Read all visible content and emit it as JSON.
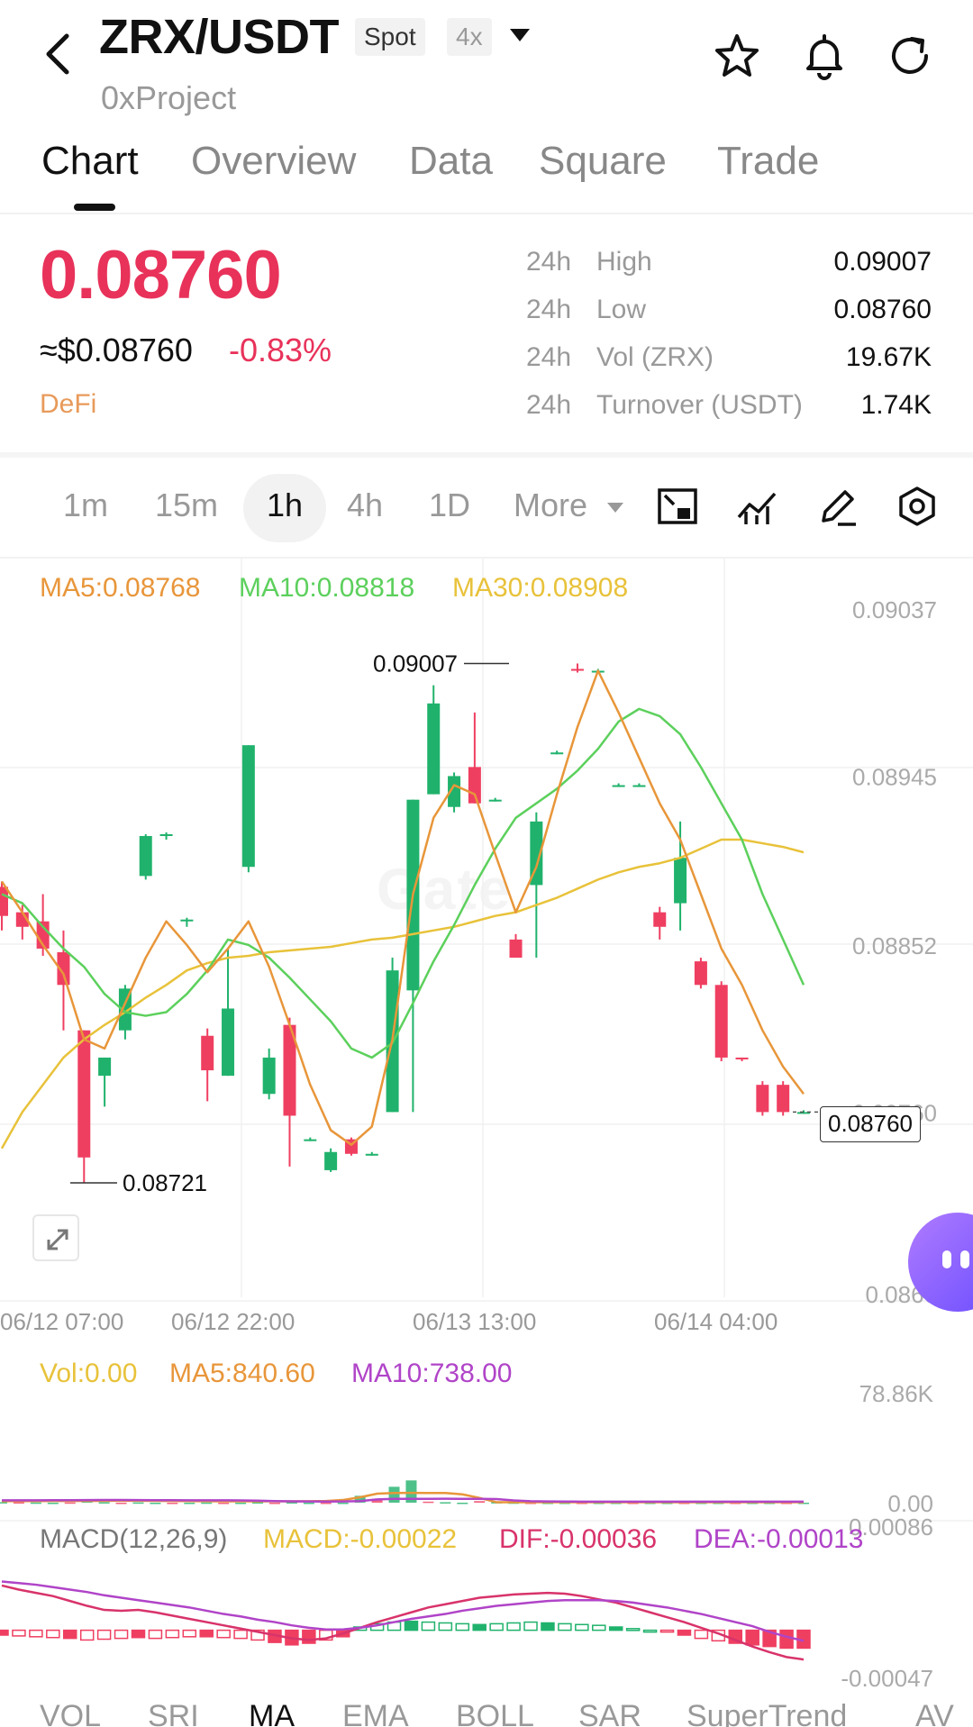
{
  "header": {
    "pair": "ZRX/USDT",
    "market_tag": "Spot",
    "leverage_tag": "4x",
    "project": "0xProject"
  },
  "tabs": [
    "Chart",
    "Overview",
    "Data",
    "Square",
    "Trade"
  ],
  "price": {
    "last": "0.08760",
    "usd": "≈$0.08760",
    "change": "-0.83%",
    "sector": "DeFi"
  },
  "stats": [
    {
      "period": "24h",
      "label": "High",
      "value": "0.09007"
    },
    {
      "period": "24h",
      "label": "Low",
      "value": "0.08760"
    },
    {
      "period": "24h",
      "label": "Vol (ZRX)",
      "value": "19.67K"
    },
    {
      "period": "24h",
      "label": "Turnover (USDT)",
      "value": "1.74K"
    }
  ],
  "intervals": [
    "1m",
    "15m",
    "1h",
    "4h",
    "1D",
    "More"
  ],
  "ma_legend": {
    "ma5": "MA5:0.08768",
    "ma10": "MA10:0.08818",
    "ma30": "MA30:0.08908"
  },
  "price_axis": [
    "0.09037",
    "0.08945",
    "0.08852",
    "0.08760",
    "0.0866"
  ],
  "annotations": {
    "high": "0.09007",
    "low": "0.08721",
    "current": "0.08760"
  },
  "watermark": "Gate",
  "time_axis": [
    "06/12 07:00",
    "06/12 22:00",
    "06/13 13:00",
    "06/14 04:00"
  ],
  "volume": {
    "legend": {
      "vol": "Vol:0.00",
      "ma5": "MA5:840.60",
      "ma10": "MA10:738.00"
    },
    "axis_top": "78.86K",
    "axis_bottom": "0.00"
  },
  "macd": {
    "legend": {
      "title": "MACD(12,26,9)",
      "macd": "MACD:-0.00022",
      "dif": "DIF:-0.00036",
      "dea": "DEA:-0.00013"
    },
    "axis_top": "0.00086",
    "axis_bottom": "-0.00047"
  },
  "indicators": [
    "VOL",
    "SRI",
    "MA",
    "EMA",
    "BOLL",
    "SAR",
    "SuperTrend",
    "AV"
  ],
  "colors": {
    "up": "#20b26c",
    "down": "#ef3f61",
    "ma5": "#e8963a",
    "ma10": "#5cd05c",
    "ma30": "#e8c23a",
    "dif": "#d8336a",
    "dea": "#b044c8"
  },
  "chart_data": [
    {
      "type": "candlestick",
      "series_name": "ZRX/USDT 1h",
      "ylim": [
        0.0866,
        0.09037
      ],
      "x": [
        "06/12 07:00",
        "06/12 22:00",
        "06/13 13:00",
        "06/14 04:00"
      ],
      "candles": [
        {
          "o": 0.08884,
          "c": 0.08868,
          "h": 0.08887,
          "l": 0.0886
        },
        {
          "o": 0.0887,
          "c": 0.08862,
          "h": 0.08874,
          "l": 0.08855
        },
        {
          "o": 0.08865,
          "c": 0.0885,
          "h": 0.0888,
          "l": 0.08846
        },
        {
          "o": 0.08848,
          "c": 0.0883,
          "h": 0.0886,
          "l": 0.08805
        },
        {
          "o": 0.08805,
          "c": 0.08735,
          "h": 0.08805,
          "l": 0.08721
        },
        {
          "o": 0.0878,
          "c": 0.0879,
          "h": 0.0879,
          "l": 0.08763
        },
        {
          "o": 0.08805,
          "c": 0.08828,
          "h": 0.0883,
          "l": 0.088
        },
        {
          "o": 0.0889,
          "c": 0.08912,
          "h": 0.08913,
          "l": 0.08888
        },
        {
          "o": 0.08912,
          "c": 0.08913,
          "h": 0.08914,
          "l": 0.0891
        },
        {
          "o": 0.08865,
          "c": 0.08866,
          "h": 0.08867,
          "l": 0.08862
        },
        {
          "o": 0.08802,
          "c": 0.08783,
          "h": 0.08806,
          "l": 0.08766
        },
        {
          "o": 0.0878,
          "c": 0.08817,
          "h": 0.0885,
          "l": 0.0878
        },
        {
          "o": 0.08895,
          "c": 0.08962,
          "h": 0.08962,
          "l": 0.08892
        },
        {
          "o": 0.0877,
          "c": 0.0879,
          "h": 0.08795,
          "l": 0.08767
        },
        {
          "o": 0.08808,
          "c": 0.08758,
          "h": 0.08812,
          "l": 0.0873
        },
        {
          "o": 0.08745,
          "c": 0.08745,
          "h": 0.08746,
          "l": 0.08744
        },
        {
          "o": 0.08728,
          "c": 0.08738,
          "h": 0.0874,
          "l": 0.08727
        },
        {
          "o": 0.08745,
          "c": 0.08737,
          "h": 0.08746,
          "l": 0.08736
        },
        {
          "o": 0.08737,
          "c": 0.08737,
          "h": 0.08738,
          "l": 0.08736
        },
        {
          "o": 0.0876,
          "c": 0.08838,
          "h": 0.08845,
          "l": 0.0876
        },
        {
          "o": 0.08827,
          "c": 0.08932,
          "h": 0.08932,
          "l": 0.0876
        },
        {
          "o": 0.08935,
          "c": 0.08985,
          "h": 0.08995,
          "l": 0.08935
        },
        {
          "o": 0.08928,
          "c": 0.08945,
          "h": 0.08947,
          "l": 0.08925
        },
        {
          "o": 0.0895,
          "c": 0.0893,
          "h": 0.0898,
          "l": 0.0893
        },
        {
          "o": 0.08932,
          "c": 0.08932,
          "h": 0.08933,
          "l": 0.08931
        },
        {
          "o": 0.08855,
          "c": 0.08845,
          "h": 0.08858,
          "l": 0.08845
        },
        {
          "o": 0.08885,
          "c": 0.0892,
          "h": 0.08925,
          "l": 0.08845
        },
        {
          "o": 0.08958,
          "c": 0.08958,
          "h": 0.08959,
          "l": 0.08957
        },
        {
          "o": 0.09004,
          "c": 0.09003,
          "h": 0.09007,
          "l": 0.09002
        },
        {
          "o": 0.09003,
          "c": 0.09003,
          "h": 0.09004,
          "l": 0.09002
        },
        {
          "o": 0.0894,
          "c": 0.0894,
          "h": 0.08941,
          "l": 0.08939
        },
        {
          "o": 0.0894,
          "c": 0.0894,
          "h": 0.08941,
          "l": 0.08939
        },
        {
          "o": 0.0887,
          "c": 0.08862,
          "h": 0.08873,
          "l": 0.08855
        },
        {
          "o": 0.08875,
          "c": 0.089,
          "h": 0.0892,
          "l": 0.0886
        },
        {
          "o": 0.08843,
          "c": 0.0883,
          "h": 0.08845,
          "l": 0.08828
        },
        {
          "o": 0.0883,
          "c": 0.0879,
          "h": 0.08832,
          "l": 0.08788
        },
        {
          "o": 0.0879,
          "c": 0.08789,
          "h": 0.0879,
          "l": 0.08788
        },
        {
          "o": 0.08775,
          "c": 0.0876,
          "h": 0.08777,
          "l": 0.08758
        },
        {
          "o": 0.08775,
          "c": 0.0876,
          "h": 0.08777,
          "l": 0.08758
        },
        {
          "o": 0.0876,
          "c": 0.0876,
          "h": 0.08761,
          "l": 0.08759
        }
      ],
      "ma5": [
        0.08887,
        0.0887,
        0.08852,
        0.08836,
        0.088,
        0.08795,
        0.0882,
        0.08845,
        0.08865,
        0.08852,
        0.08837,
        0.0885,
        0.08865,
        0.0884,
        0.08808,
        0.08775,
        0.0875,
        0.08742,
        0.08752,
        0.088,
        0.0888,
        0.08922,
        0.0894,
        0.08935,
        0.08902,
        0.0887,
        0.08895,
        0.08935,
        0.08972,
        0.09003,
        0.0898,
        0.08955,
        0.0893,
        0.0891,
        0.0888,
        0.0885,
        0.0883,
        0.08805,
        0.08785,
        0.0877
      ],
      "ma10": [
        0.0888,
        0.08875,
        0.08862,
        0.0885,
        0.0884,
        0.08825,
        0.08815,
        0.08813,
        0.08815,
        0.08825,
        0.08838,
        0.08855,
        0.08852,
        0.08845,
        0.08834,
        0.08822,
        0.0881,
        0.08795,
        0.0879,
        0.08798,
        0.0882,
        0.08843,
        0.08863,
        0.08885,
        0.08905,
        0.08922,
        0.0893,
        0.08938,
        0.08948,
        0.0896,
        0.08975,
        0.08982,
        0.08978,
        0.08968,
        0.0895,
        0.0893,
        0.0891,
        0.0888,
        0.08855,
        0.0883
      ],
      "ma30": [
        0.0874,
        0.0876,
        0.08775,
        0.0879,
        0.088,
        0.08808,
        0.08815,
        0.08823,
        0.0883,
        0.08838,
        0.08842,
        0.08845,
        0.08846,
        0.08848,
        0.08849,
        0.0885,
        0.08851,
        0.08853,
        0.08855,
        0.08856,
        0.08858,
        0.0886,
        0.08862,
        0.08865,
        0.08868,
        0.0887,
        0.08874,
        0.08878,
        0.08883,
        0.08888,
        0.08892,
        0.08895,
        0.08897,
        0.089,
        0.08905,
        0.0891,
        0.0891,
        0.08908,
        0.08906,
        0.08903
      ]
    },
    {
      "type": "bar",
      "series_name": "Volume",
      "ylim": [
        0,
        78860
      ],
      "values": [
        400,
        300,
        150,
        0,
        200,
        1900,
        350,
        0,
        220,
        0,
        0,
        0,
        150,
        0,
        0,
        320,
        0,
        320,
        0,
        0,
        0,
        5200,
        3000,
        12000,
        16800,
        800,
        350,
        0,
        1200,
        400,
        150,
        0,
        0,
        0,
        0,
        0,
        0,
        0,
        0,
        0,
        0,
        0,
        0,
        0,
        0,
        0,
        0,
        0
      ],
      "ma5": [
        1100,
        1150,
        1200,
        1250,
        1300,
        1350,
        1400,
        1450,
        1450,
        1400,
        1300,
        1200,
        1100,
        1000,
        1000,
        1000,
        1000,
        1050,
        1100,
        1300,
        2000,
        4100,
        6800,
        7300,
        7400,
        7300,
        7300,
        6300,
        3600,
        300,
        300,
        300,
        300,
        300,
        300,
        300,
        300,
        300,
        300,
        300,
        300,
        300,
        300,
        300,
        300,
        300,
        300,
        300
      ],
      "ma10": [
        1800,
        1800,
        1800,
        1850,
        1900,
        1950,
        2000,
        2000,
        1950,
        1900,
        1850,
        1800,
        1800,
        1800,
        1700,
        1500,
        1200,
        1000,
        900,
        850,
        900,
        1200,
        2500,
        2900,
        2900,
        2900,
        2950,
        2900,
        2850,
        2700,
        1700,
        1100,
        900,
        850,
        800,
        800,
        800,
        800,
        800,
        800,
        800,
        800,
        800,
        800,
        800,
        800,
        800,
        800
      ]
    },
    {
      "type": "macd",
      "series_name": "MACD(12,26,9)",
      "ylim": [
        -0.00047,
        0.00086
      ],
      "hist": [
        -6e-05,
        -7e-05,
        -8e-05,
        -9e-05,
        -0.0001,
        -0.00012,
        -0.00011,
        -0.0001,
        -9e-05,
        -0.0001,
        -9e-05,
        -8e-05,
        -8e-05,
        -9e-05,
        -0.0001,
        -0.00012,
        -0.00015,
        -0.00018,
        -0.00016,
        -0.00012,
        -8e-05,
        4e-05,
        8e-05,
        0.0001,
        0.00011,
        0.0001,
        9e-05,
        8e-05,
        7e-05,
        8e-05,
        9e-05,
        0.0001,
        9e-05,
        8e-05,
        7e-05,
        6e-05,
        4e-05,
        2e-05,
        0,
        -2e-05,
        -6e-05,
        -0.0001,
        -0.00013,
        -0.00016,
        -0.00018,
        -0.0002,
        -0.00022,
        -0.00022
      ],
      "dif": [
        0.00055,
        0.0005,
        0.00046,
        0.00042,
        0.00036,
        0.0003,
        0.00025,
        0.00024,
        0.00025,
        0.00022,
        0.00018,
        0.00014,
        0.0001,
        6e-05,
        2e-05,
        -2e-05,
        -6e-05,
        -0.0001,
        -0.00012,
        -0.0001,
        -4e-05,
        3e-05,
        0.0001,
        0.00016,
        0.00022,
        0.00028,
        0.00032,
        0.00036,
        0.0004,
        0.00042,
        0.00044,
        0.00045,
        0.00046,
        0.00045,
        0.00042,
        0.00038,
        0.00034,
        0.00028,
        0.00022,
        0.00016,
        0.0001,
        3e-05,
        -4e-05,
        -0.00012,
        -0.0002,
        -0.00027,
        -0.00033,
        -0.00036
      ],
      "dea": [
        0.0006,
        0.00058,
        0.00056,
        0.00053,
        0.0005,
        0.00047,
        0.00043,
        0.0004,
        0.00037,
        0.00034,
        0.00031,
        0.00028,
        0.00024,
        0.0002,
        0.00017,
        0.00013,
        0.0001,
        6e-05,
        3e-05,
        1e-05,
        1e-05,
        3e-05,
        6e-05,
        0.0001,
        0.00014,
        0.00017,
        0.0002,
        0.00024,
        0.00027,
        0.0003,
        0.00032,
        0.00034,
        0.00036,
        0.00037,
        0.00037,
        0.00037,
        0.00036,
        0.00034,
        0.00031,
        0.00028,
        0.00024,
        0.0002,
        0.00015,
        0.0001,
        5e-05,
        -2e-05,
        -8e-05,
        -0.00013
      ]
    }
  ]
}
